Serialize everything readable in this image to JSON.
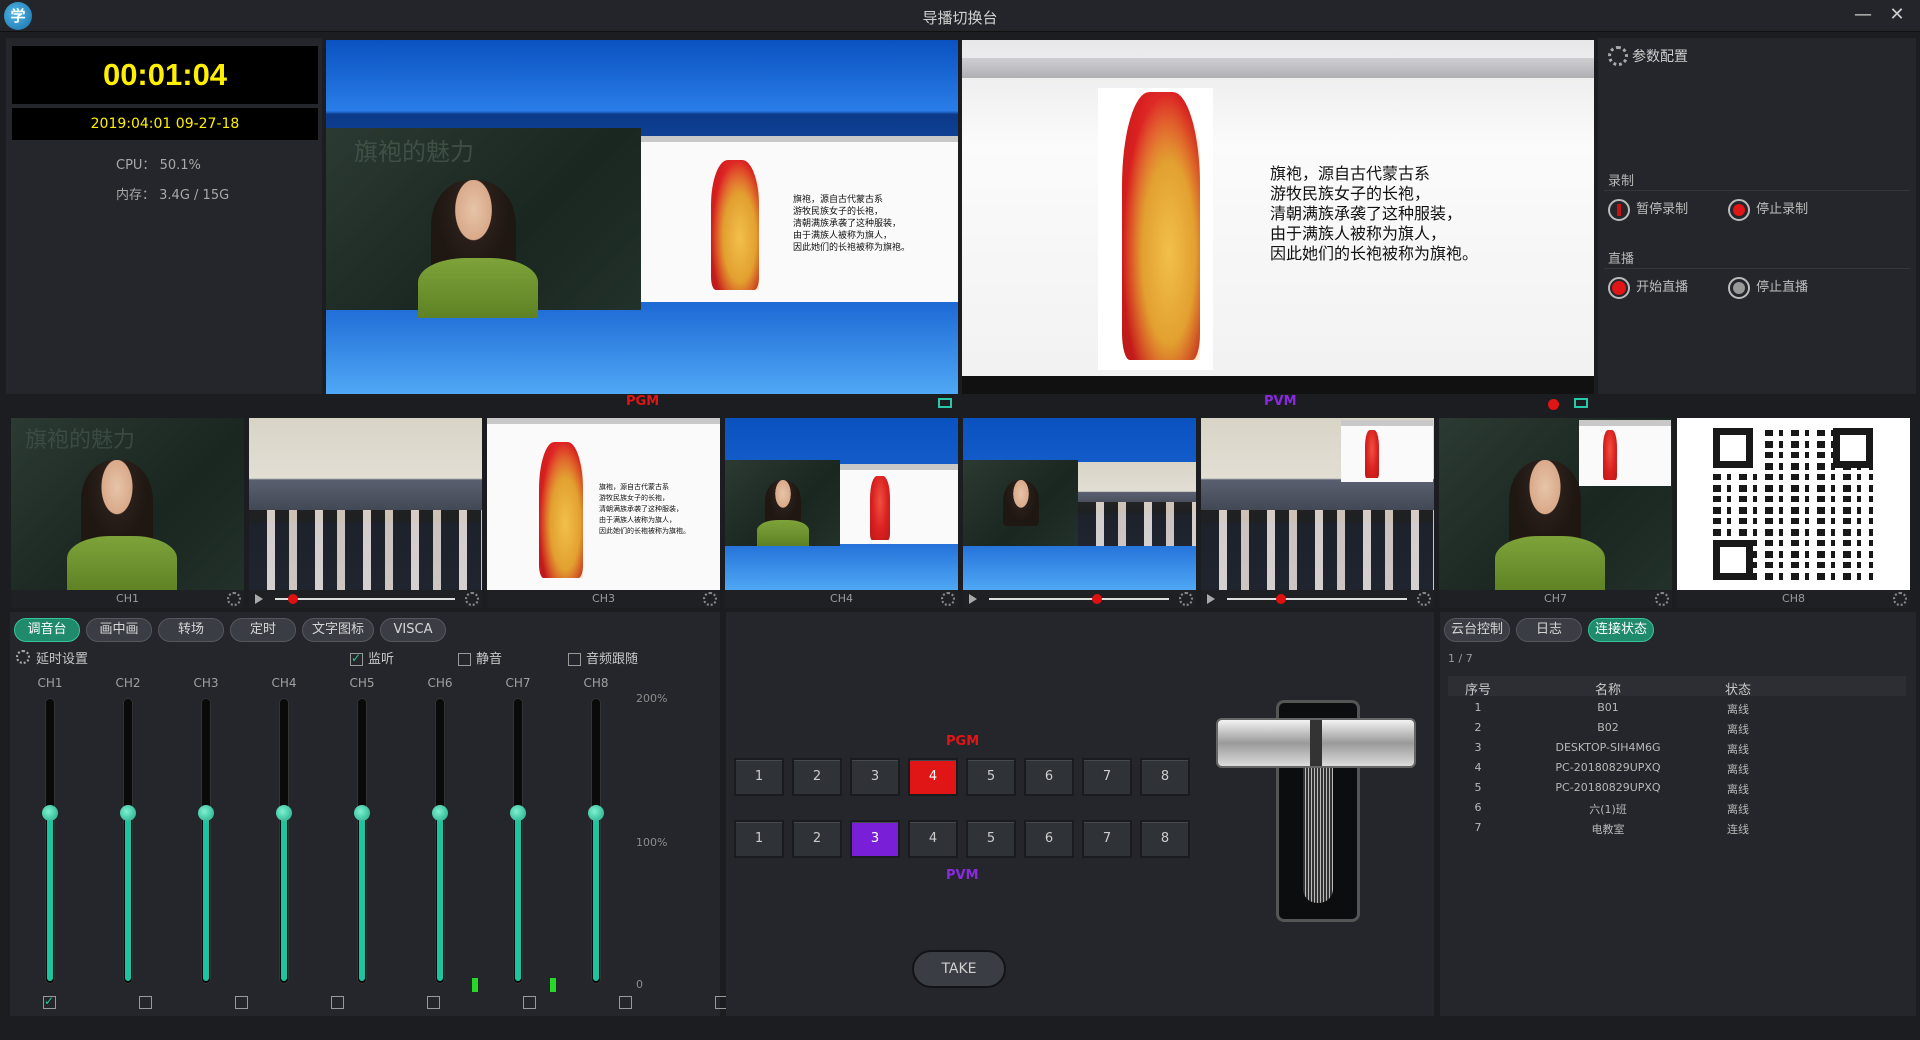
{
  "window": {
    "title": "导播切换台",
    "logo": "学",
    "minimize": "—",
    "close": "✕"
  },
  "status": {
    "timer": "00:01:04",
    "datetime": "2019:04:01 09-27-18",
    "cpu_label": "CPU：",
    "cpu_value": "50.1%",
    "mem_label": "内存：",
    "mem_value": "3.4G / 15G"
  },
  "monitors": {
    "pgm_label": "PGM",
    "pvm_label": "PVM",
    "pgm_slide_text": "旗袍，源自古代蒙古系\n游牧民族女子的长袍，\n清朝满族承袭了这种服装，\n由于满族人被称为旗人，\n因此她们的长袍被称为旗袍。",
    "pvm_slide_text": "旗袍，源自古代蒙古系\n游牧民族女子的长袍，\n清朝满族承袭了这种服装，\n由于满族人被称为旗人，\n因此她们的长袍被称为旗袍。",
    "chalk_text": "旗袍的魅力"
  },
  "config": {
    "title": "参数配置",
    "record_section": "录制",
    "pause_record": "暂停录制",
    "stop_record": "停止录制",
    "live_section": "直播",
    "start_live": "开始直播",
    "stop_live": "停止直播"
  },
  "channels": [
    {
      "label": "CH1",
      "type": "camera"
    },
    {
      "label": "",
      "type": "video",
      "progress": 0.1
    },
    {
      "label": "CH3",
      "type": "slide"
    },
    {
      "label": "CH4",
      "type": "pip"
    },
    {
      "label": "",
      "type": "video",
      "progress": 0.6
    },
    {
      "label": "",
      "type": "video",
      "progress": 0.3
    },
    {
      "label": "CH7",
      "type": "camera"
    },
    {
      "label": "CH8",
      "type": "qr"
    }
  ],
  "audio": {
    "tabs": [
      "调音台",
      "画中画",
      "转场",
      "定时",
      "文字图标",
      "VISCA"
    ],
    "delay_label": "延时设置",
    "monitor_label": "监听",
    "mute_label": "静音",
    "follow_label": "音频跟随",
    "scale": [
      "200%",
      "100%",
      "0"
    ],
    "faders": [
      {
        "label": "CH1",
        "level": 0.4,
        "checked": true
      },
      {
        "label": "CH2",
        "level": 0.4,
        "checked": false
      },
      {
        "label": "CH3",
        "level": 0.4,
        "checked": false
      },
      {
        "label": "CH4",
        "level": 0.4,
        "checked": false
      },
      {
        "label": "CH5",
        "level": 0.4,
        "checked": false
      },
      {
        "label": "CH6",
        "level": 0.4,
        "checked": false
      },
      {
        "label": "CH7",
        "level": 0.4,
        "checked": false
      },
      {
        "label": "CH8",
        "level": 0.4,
        "checked": false
      }
    ]
  },
  "switcher": {
    "pgm_label": "PGM",
    "pvm_label": "PVM",
    "pgm_buttons": [
      "1",
      "2",
      "3",
      "4",
      "5",
      "6",
      "7",
      "8"
    ],
    "pgm_active": 4,
    "pvm_buttons": [
      "1",
      "2",
      "3",
      "4",
      "5",
      "6",
      "7",
      "8"
    ],
    "pvm_active": 3,
    "take_label": "TAKE"
  },
  "connections": {
    "tabs": [
      "云台控制",
      "日志",
      "连接状态"
    ],
    "page": "1 / 7",
    "headers": [
      "序号",
      "名称",
      "状态"
    ],
    "rows": [
      [
        "1",
        "B01",
        "离线"
      ],
      [
        "2",
        "B02",
        "离线"
      ],
      [
        "3",
        "DESKTOP-SIH4M6G",
        "离线"
      ],
      [
        "4",
        "PC-20180829UPXQ",
        "离线"
      ],
      [
        "5",
        "PC-20180829UPXQ",
        "离线"
      ],
      [
        "6",
        "六(1)班",
        "离线"
      ],
      [
        "7",
        "电教室",
        "连线"
      ]
    ]
  },
  "colors": {
    "pgm": "#e01515",
    "pvm": "#7a1fd8",
    "accent": "#1cc4a0",
    "timer": "#fff000"
  }
}
